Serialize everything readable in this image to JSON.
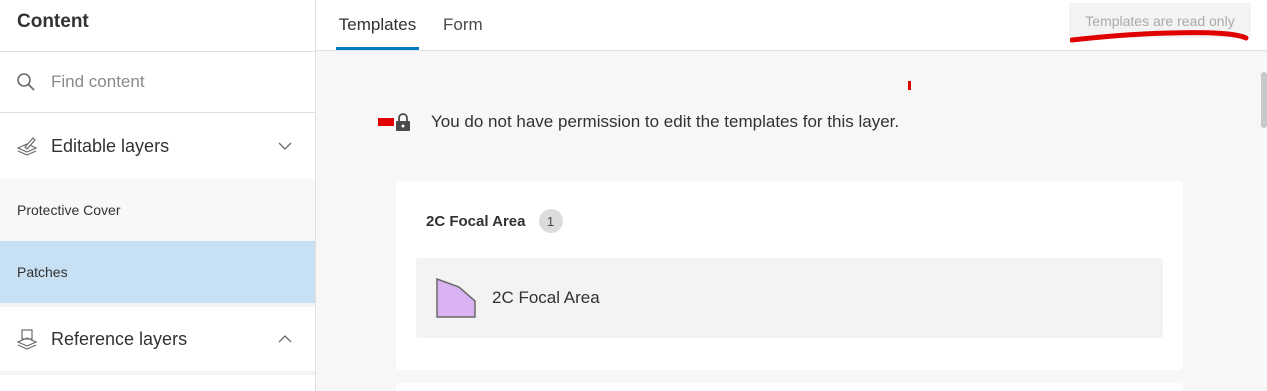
{
  "sidebar": {
    "title": "Content",
    "search": {
      "placeholder": "Find content",
      "value": ""
    },
    "groups": [
      {
        "label": "Editable layers",
        "expanded": true,
        "icon": "editable-layers-icon"
      },
      {
        "label": "Reference layers",
        "expanded": false,
        "icon": "reference-layers-icon"
      }
    ],
    "layers": [
      {
        "label": "Protective Cover",
        "selected": false
      },
      {
        "label": "Patches",
        "selected": true
      }
    ]
  },
  "main": {
    "tabs": [
      {
        "label": "Templates",
        "active": true
      },
      {
        "label": "Form",
        "active": false
      }
    ],
    "readonly_badge": "Templates are read only",
    "permission_message": "You do not have permission to edit the templates for this layer.",
    "template_group": {
      "title": "2C Focal Area",
      "count": "1",
      "items": [
        {
          "label": "2C Focal Area",
          "icon": "polygon-symbol-icon",
          "fill": "#d9b3f2"
        }
      ]
    }
  },
  "colors": {
    "accent": "#007ac2",
    "selected_bg": "#c7e0f4",
    "annotation": "#e00000"
  }
}
